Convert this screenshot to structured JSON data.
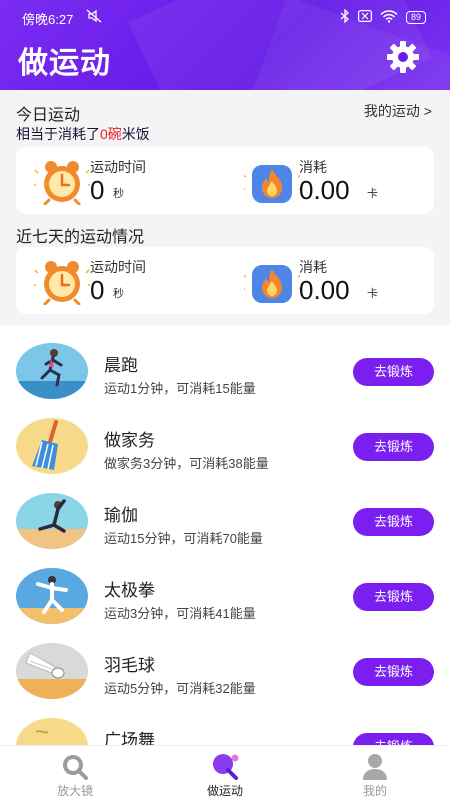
{
  "status_bar": {
    "time": "傍晚6:27",
    "battery": "89"
  },
  "header": {
    "title": "做运动"
  },
  "today": {
    "heading": "今日运动",
    "link": "我的运动 >",
    "equiv_prefix": "相当于消耗了",
    "equiv_count": "0碗",
    "equiv_suffix": "米饭",
    "time_label": "运动时间",
    "time_value": "0",
    "time_unit": "秒",
    "cal_label": "消耗",
    "cal_value": "0.00",
    "cal_unit": "卡"
  },
  "week": {
    "heading": "近七天的运动情况",
    "time_label": "运动时间",
    "time_value": "0",
    "time_unit": "秒",
    "cal_label": "消耗",
    "cal_value": "0.00",
    "cal_unit": "卡"
  },
  "exercises": [
    {
      "name": "晨跑",
      "desc": "运动1分钟，可消耗15能量",
      "button": "去锻炼"
    },
    {
      "name": "做家务",
      "desc": "做家务3分钟，可消耗38能量",
      "button": "去锻炼"
    },
    {
      "name": "瑜伽",
      "desc": "运动15分钟，可消耗70能量",
      "button": "去锻炼"
    },
    {
      "name": "太极拳",
      "desc": "运动3分钟，可消耗41能量",
      "button": "去锻炼"
    },
    {
      "name": "羽毛球",
      "desc": "运动5分钟，可消耗32能量",
      "button": "去锻炼"
    },
    {
      "name": "广场舞",
      "desc": "",
      "button": "去锻炼"
    }
  ],
  "tabs": [
    {
      "label": "放大镜",
      "icon": "magnifier-icon",
      "color": "#999999"
    },
    {
      "label": "做运动",
      "icon": "ping-pong-icon",
      "color": "#222222"
    },
    {
      "label": "我的",
      "icon": "user-icon",
      "color": "#999999"
    }
  ],
  "colors": {
    "accent": "#7a1ff0",
    "header": "#6a1eea",
    "highlight": "#e6212a"
  }
}
